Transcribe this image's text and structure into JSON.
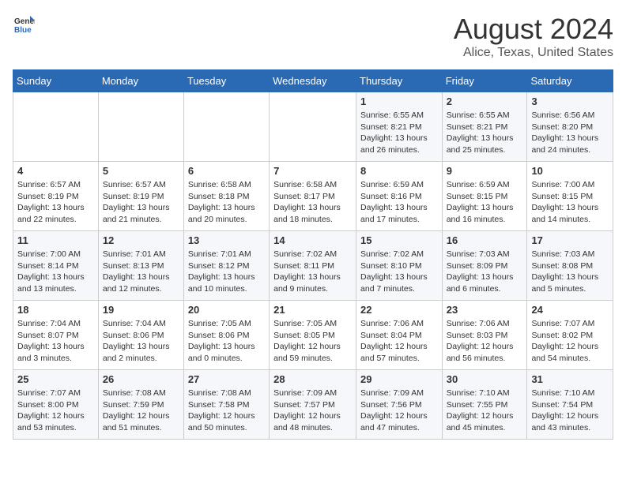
{
  "header": {
    "logo_general": "General",
    "logo_blue": "Blue",
    "title": "August 2024",
    "subtitle": "Alice, Texas, United States"
  },
  "days_of_week": [
    "Sunday",
    "Monday",
    "Tuesday",
    "Wednesday",
    "Thursday",
    "Friday",
    "Saturday"
  ],
  "weeks": [
    [
      {
        "day": "",
        "detail": ""
      },
      {
        "day": "",
        "detail": ""
      },
      {
        "day": "",
        "detail": ""
      },
      {
        "day": "",
        "detail": ""
      },
      {
        "day": "1",
        "detail": "Sunrise: 6:55 AM\nSunset: 8:21 PM\nDaylight: 13 hours\nand 26 minutes."
      },
      {
        "day": "2",
        "detail": "Sunrise: 6:55 AM\nSunset: 8:21 PM\nDaylight: 13 hours\nand 25 minutes."
      },
      {
        "day": "3",
        "detail": "Sunrise: 6:56 AM\nSunset: 8:20 PM\nDaylight: 13 hours\nand 24 minutes."
      }
    ],
    [
      {
        "day": "4",
        "detail": "Sunrise: 6:57 AM\nSunset: 8:19 PM\nDaylight: 13 hours\nand 22 minutes."
      },
      {
        "day": "5",
        "detail": "Sunrise: 6:57 AM\nSunset: 8:19 PM\nDaylight: 13 hours\nand 21 minutes."
      },
      {
        "day": "6",
        "detail": "Sunrise: 6:58 AM\nSunset: 8:18 PM\nDaylight: 13 hours\nand 20 minutes."
      },
      {
        "day": "7",
        "detail": "Sunrise: 6:58 AM\nSunset: 8:17 PM\nDaylight: 13 hours\nand 18 minutes."
      },
      {
        "day": "8",
        "detail": "Sunrise: 6:59 AM\nSunset: 8:16 PM\nDaylight: 13 hours\nand 17 minutes."
      },
      {
        "day": "9",
        "detail": "Sunrise: 6:59 AM\nSunset: 8:15 PM\nDaylight: 13 hours\nand 16 minutes."
      },
      {
        "day": "10",
        "detail": "Sunrise: 7:00 AM\nSunset: 8:15 PM\nDaylight: 13 hours\nand 14 minutes."
      }
    ],
    [
      {
        "day": "11",
        "detail": "Sunrise: 7:00 AM\nSunset: 8:14 PM\nDaylight: 13 hours\nand 13 minutes."
      },
      {
        "day": "12",
        "detail": "Sunrise: 7:01 AM\nSunset: 8:13 PM\nDaylight: 13 hours\nand 12 minutes."
      },
      {
        "day": "13",
        "detail": "Sunrise: 7:01 AM\nSunset: 8:12 PM\nDaylight: 13 hours\nand 10 minutes."
      },
      {
        "day": "14",
        "detail": "Sunrise: 7:02 AM\nSunset: 8:11 PM\nDaylight: 13 hours\nand 9 minutes."
      },
      {
        "day": "15",
        "detail": "Sunrise: 7:02 AM\nSunset: 8:10 PM\nDaylight: 13 hours\nand 7 minutes."
      },
      {
        "day": "16",
        "detail": "Sunrise: 7:03 AM\nSunset: 8:09 PM\nDaylight: 13 hours\nand 6 minutes."
      },
      {
        "day": "17",
        "detail": "Sunrise: 7:03 AM\nSunset: 8:08 PM\nDaylight: 13 hours\nand 5 minutes."
      }
    ],
    [
      {
        "day": "18",
        "detail": "Sunrise: 7:04 AM\nSunset: 8:07 PM\nDaylight: 13 hours\nand 3 minutes."
      },
      {
        "day": "19",
        "detail": "Sunrise: 7:04 AM\nSunset: 8:06 PM\nDaylight: 13 hours\nand 2 minutes."
      },
      {
        "day": "20",
        "detail": "Sunrise: 7:05 AM\nSunset: 8:06 PM\nDaylight: 13 hours\nand 0 minutes."
      },
      {
        "day": "21",
        "detail": "Sunrise: 7:05 AM\nSunset: 8:05 PM\nDaylight: 12 hours\nand 59 minutes."
      },
      {
        "day": "22",
        "detail": "Sunrise: 7:06 AM\nSunset: 8:04 PM\nDaylight: 12 hours\nand 57 minutes."
      },
      {
        "day": "23",
        "detail": "Sunrise: 7:06 AM\nSunset: 8:03 PM\nDaylight: 12 hours\nand 56 minutes."
      },
      {
        "day": "24",
        "detail": "Sunrise: 7:07 AM\nSunset: 8:02 PM\nDaylight: 12 hours\nand 54 minutes."
      }
    ],
    [
      {
        "day": "25",
        "detail": "Sunrise: 7:07 AM\nSunset: 8:00 PM\nDaylight: 12 hours\nand 53 minutes."
      },
      {
        "day": "26",
        "detail": "Sunrise: 7:08 AM\nSunset: 7:59 PM\nDaylight: 12 hours\nand 51 minutes."
      },
      {
        "day": "27",
        "detail": "Sunrise: 7:08 AM\nSunset: 7:58 PM\nDaylight: 12 hours\nand 50 minutes."
      },
      {
        "day": "28",
        "detail": "Sunrise: 7:09 AM\nSunset: 7:57 PM\nDaylight: 12 hours\nand 48 minutes."
      },
      {
        "day": "29",
        "detail": "Sunrise: 7:09 AM\nSunset: 7:56 PM\nDaylight: 12 hours\nand 47 minutes."
      },
      {
        "day": "30",
        "detail": "Sunrise: 7:10 AM\nSunset: 7:55 PM\nDaylight: 12 hours\nand 45 minutes."
      },
      {
        "day": "31",
        "detail": "Sunrise: 7:10 AM\nSunset: 7:54 PM\nDaylight: 12 hours\nand 43 minutes."
      }
    ]
  ]
}
